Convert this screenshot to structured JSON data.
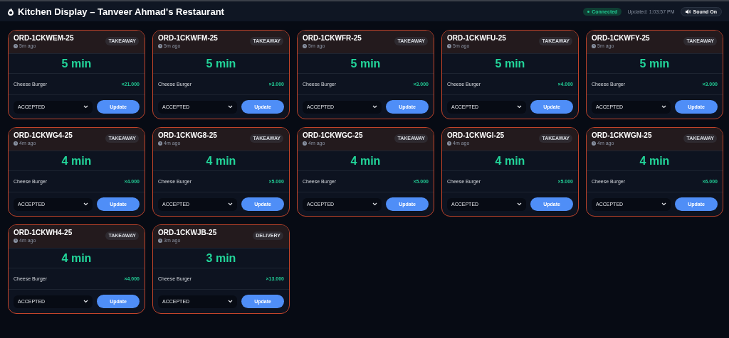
{
  "header": {
    "title": "Kitchen Display – Tanveer Ahmad's Restaurant",
    "connection": {
      "label": "Connected",
      "connected": true
    },
    "updated": "Updated: 1:03:57 PM",
    "sound": {
      "label": "Sound On",
      "on": true
    }
  },
  "orders": [
    {
      "id": "ORD-1CKWEM-25",
      "age": "5m ago",
      "type": "TAKEAWAY",
      "timer": "5 min",
      "items": [
        {
          "name": "Cheese Burger",
          "qty": "×21.000"
        }
      ],
      "status": "ACCEPTED",
      "action": "Update"
    },
    {
      "id": "ORD-1CKWFM-25",
      "age": "5m ago",
      "type": "TAKEAWAY",
      "timer": "5 min",
      "items": [
        {
          "name": "Cheese Burger",
          "qty": "×3.000"
        }
      ],
      "status": "ACCEPTED",
      "action": "Update"
    },
    {
      "id": "ORD-1CKWFR-25",
      "age": "5m ago",
      "type": "TAKEAWAY",
      "timer": "5 min",
      "items": [
        {
          "name": "Cheese Burger",
          "qty": "×3.000"
        }
      ],
      "status": "ACCEPTED",
      "action": "Update"
    },
    {
      "id": "ORD-1CKWFU-25",
      "age": "5m ago",
      "type": "TAKEAWAY",
      "timer": "5 min",
      "items": [
        {
          "name": "Cheese Burger",
          "qty": "×4.000"
        }
      ],
      "status": "ACCEPTED",
      "action": "Update"
    },
    {
      "id": "ORD-1CKWFY-25",
      "age": "5m ago",
      "type": "TAKEAWAY",
      "timer": "5 min",
      "items": [
        {
          "name": "Cheese Burger",
          "qty": "×3.000"
        }
      ],
      "status": "ACCEPTED",
      "action": "Update"
    },
    {
      "id": "ORD-1CKWG4-25",
      "age": "4m ago",
      "type": "TAKEAWAY",
      "timer": "4 min",
      "items": [
        {
          "name": "Cheese Burger",
          "qty": "×4.000"
        }
      ],
      "status": "ACCEPTED",
      "action": "Update"
    },
    {
      "id": "ORD-1CKWG8-25",
      "age": "4m ago",
      "type": "TAKEAWAY",
      "timer": "4 min",
      "items": [
        {
          "name": "Cheese Burger",
          "qty": "×5.000"
        }
      ],
      "status": "ACCEPTED",
      "action": "Update"
    },
    {
      "id": "ORD-1CKWGC-25",
      "age": "4m ago",
      "type": "TAKEAWAY",
      "timer": "4 min",
      "items": [
        {
          "name": "Cheese Burger",
          "qty": "×5.000"
        }
      ],
      "status": "ACCEPTED",
      "action": "Update"
    },
    {
      "id": "ORD-1CKWGI-25",
      "age": "4m ago",
      "type": "TAKEAWAY",
      "timer": "4 min",
      "items": [
        {
          "name": "Cheese Burger",
          "qty": "×5.000"
        }
      ],
      "status": "ACCEPTED",
      "action": "Update"
    },
    {
      "id": "ORD-1CKWGN-25",
      "age": "4m ago",
      "type": "TAKEAWAY",
      "timer": "4 min",
      "items": [
        {
          "name": "Cheese Burger",
          "qty": "×6.000"
        }
      ],
      "status": "ACCEPTED",
      "action": "Update"
    },
    {
      "id": "ORD-1CKWH4-25",
      "age": "4m ago",
      "type": "TAKEAWAY",
      "timer": "4 min",
      "items": [
        {
          "name": "Cheese Burger",
          "qty": "×4.000"
        }
      ],
      "status": "ACCEPTED",
      "action": "Update"
    },
    {
      "id": "ORD-1CKWJB-25",
      "age": "3m ago",
      "type": "DELIVERY",
      "timer": "3 min",
      "items": [
        {
          "name": "Cheese Burger",
          "qty": "×13.000"
        }
      ],
      "status": "ACCEPTED",
      "action": "Update"
    }
  ]
}
